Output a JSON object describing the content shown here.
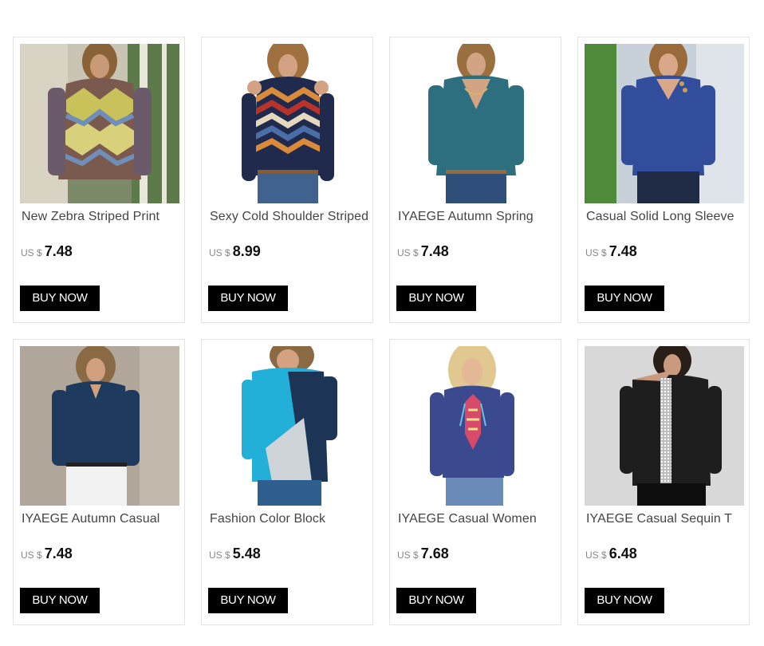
{
  "currency": "US $",
  "buy_label": "BUY NOW",
  "products": [
    {
      "title": "New Zebra Striped Print",
      "price": "7.48",
      "image": "woman-argyle-sweater"
    },
    {
      "title": "Sexy Cold Shoulder Striped",
      "price": "8.99",
      "image": "woman-chevron-cold-shoulder-top"
    },
    {
      "title": "IYAEGE Autumn Spring",
      "price": "7.48",
      "image": "woman-teal-vneck-top"
    },
    {
      "title": "Casual Solid Long Sleeve",
      "price": "7.48",
      "image": "woman-blue-button-top"
    },
    {
      "title": "IYAEGE Autumn Casual",
      "price": "7.48",
      "image": "woman-navy-vneck-blouse"
    },
    {
      "title": "Fashion Color Block",
      "price": "5.48",
      "image": "woman-color-block-top"
    },
    {
      "title": "IYAEGE Casual Women",
      "price": "7.68",
      "image": "woman-embroidered-tie-top"
    },
    {
      "title": "IYAEGE Casual Sequin T",
      "price": "6.48",
      "image": "woman-black-sequin-top"
    }
  ]
}
